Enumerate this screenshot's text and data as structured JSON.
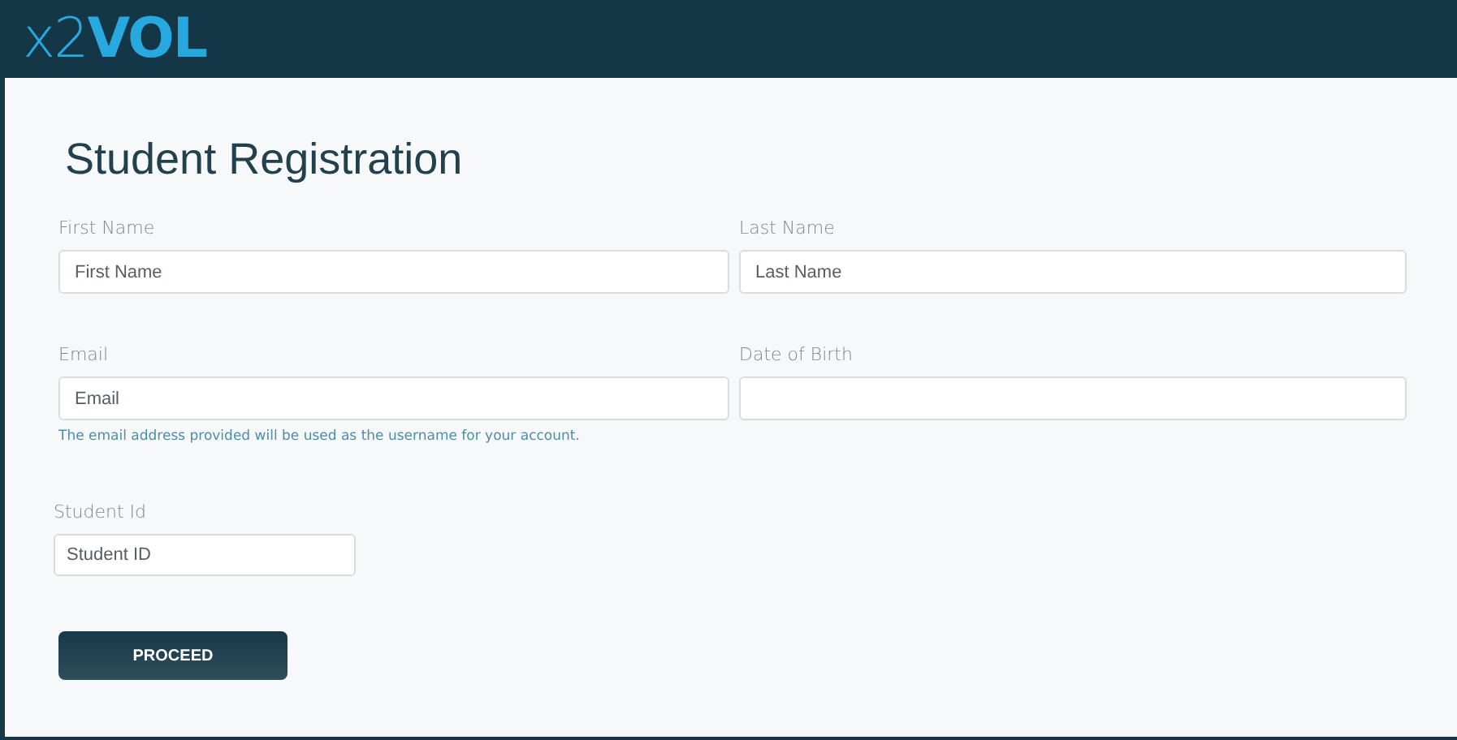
{
  "header": {
    "logo": "x2**VOL**"
  },
  "page": {
    "title": "Student Registration"
  },
  "fields": [
    {
      "label": "First Name",
      "placeholder": "First Name"
    },
    {
      "label": "Last Name",
      "placeholder": "Last Name"
    },
    {
      "label": "Email",
      "placeholder": "Email",
      "help": "The email address provided will be used as the username for your account."
    },
    {
      "label": "Date of Birth"
    }
  ],
  "student_id": {
    "label": "Student Id",
    "placeholder": "Student ID"
  },
  "buttons": [
    "PROCEED"
  ]
}
